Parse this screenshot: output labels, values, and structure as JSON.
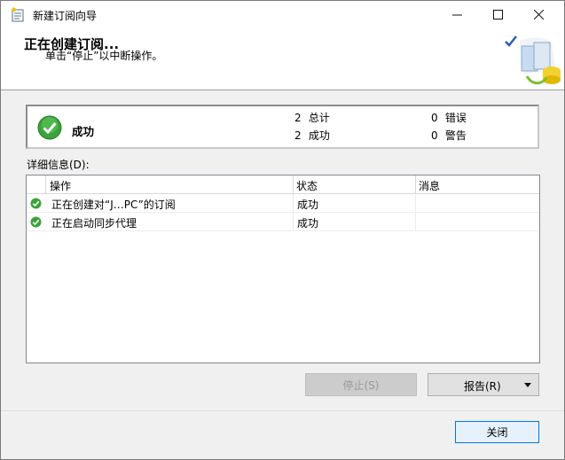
{
  "window": {
    "title": "新建订阅向导",
    "controls": {
      "minimize": "—",
      "maximize": "☐",
      "close": "✕"
    }
  },
  "banner": {
    "title": "正在创建订阅...",
    "subtitle": "单击“停止”以中断操作。"
  },
  "summary": {
    "status_label": "成功",
    "total_count": "2",
    "total_label": "总计",
    "success_count": "2",
    "success_label": "成功",
    "error_count": "0",
    "error_label": "错误",
    "warning_count": "0",
    "warning_label": "警告"
  },
  "details": {
    "label": "详细信息(D):",
    "columns": [
      "操作",
      "状态",
      "消息"
    ],
    "rows": [
      {
        "action": "正在创建对“J…PC”的订阅",
        "status": "成功",
        "message": ""
      },
      {
        "action": "正在启动同步代理",
        "status": "成功",
        "message": ""
      }
    ]
  },
  "buttons": {
    "stop": "停止(S)",
    "report": "报告(R)",
    "close": "关闭"
  },
  "colors": {
    "success_green": "#3aa33a",
    "accent_blue": "#0078d7"
  }
}
